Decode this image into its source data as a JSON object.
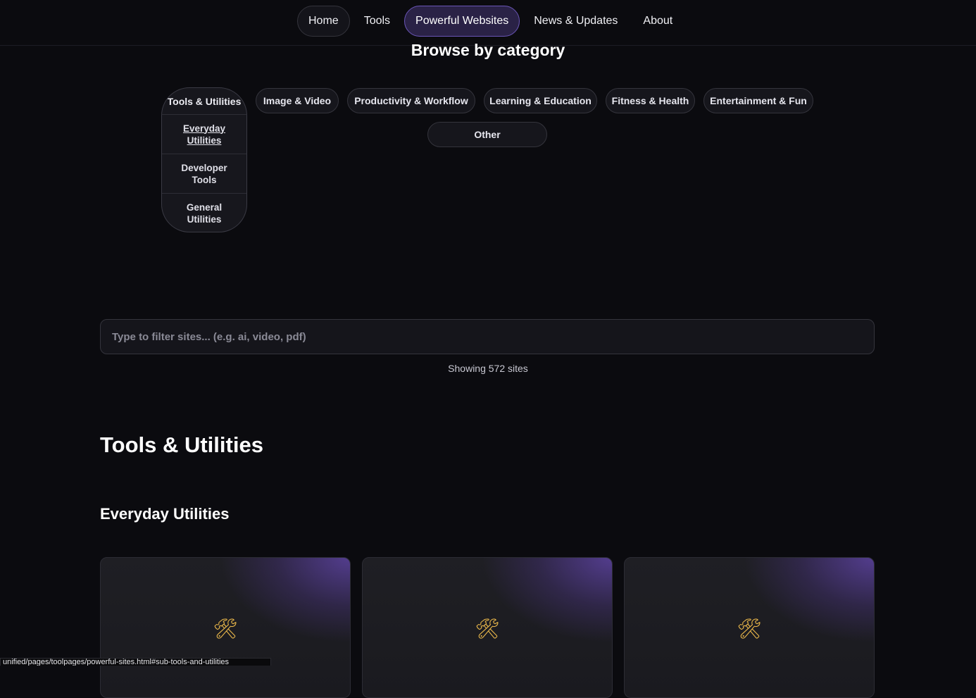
{
  "nav": {
    "items": [
      {
        "label": "Home"
      },
      {
        "label": "Tools"
      },
      {
        "label": "Powerful Websites"
      },
      {
        "label": "News & Updates"
      },
      {
        "label": "About"
      }
    ],
    "active": "Powerful Websites"
  },
  "browse": {
    "title": "Browse by category",
    "dropdown": {
      "label": "Tools & Utilities",
      "items": [
        {
          "label": "Everyday Utilities"
        },
        {
          "label": "Developer Tools"
        },
        {
          "label": "General Utilities"
        }
      ]
    },
    "categories": [
      {
        "label": "Image & Video"
      },
      {
        "label": "Productivity & Workflow"
      },
      {
        "label": "Learning & Education"
      },
      {
        "label": "Fitness & Health"
      },
      {
        "label": "Entertainment & Fun"
      },
      {
        "label": "Other"
      }
    ]
  },
  "search": {
    "placeholder": "Type to filter sites... (e.g. ai, video, pdf)",
    "value": ""
  },
  "results": {
    "count_text": "Showing 572 sites"
  },
  "section": {
    "title": "Tools & Utilities",
    "subsection_title": "Everyday Utilities",
    "cards": [
      {
        "icon": "hammer-and-wrench-icon",
        "glyph": "🛠"
      },
      {
        "icon": "hammer-and-wrench-icon",
        "glyph": "🛠"
      },
      {
        "icon": "hammer-and-wrench-icon",
        "glyph": "🛠"
      }
    ]
  },
  "status_bar": {
    "url": "unified/pages/toolpages/powerful-sites.html#sub-tools-and-utilities"
  },
  "colors": {
    "background": "#0b0b0f",
    "accent": "#6b56b8",
    "active_nav_bg": "#2a2246"
  }
}
